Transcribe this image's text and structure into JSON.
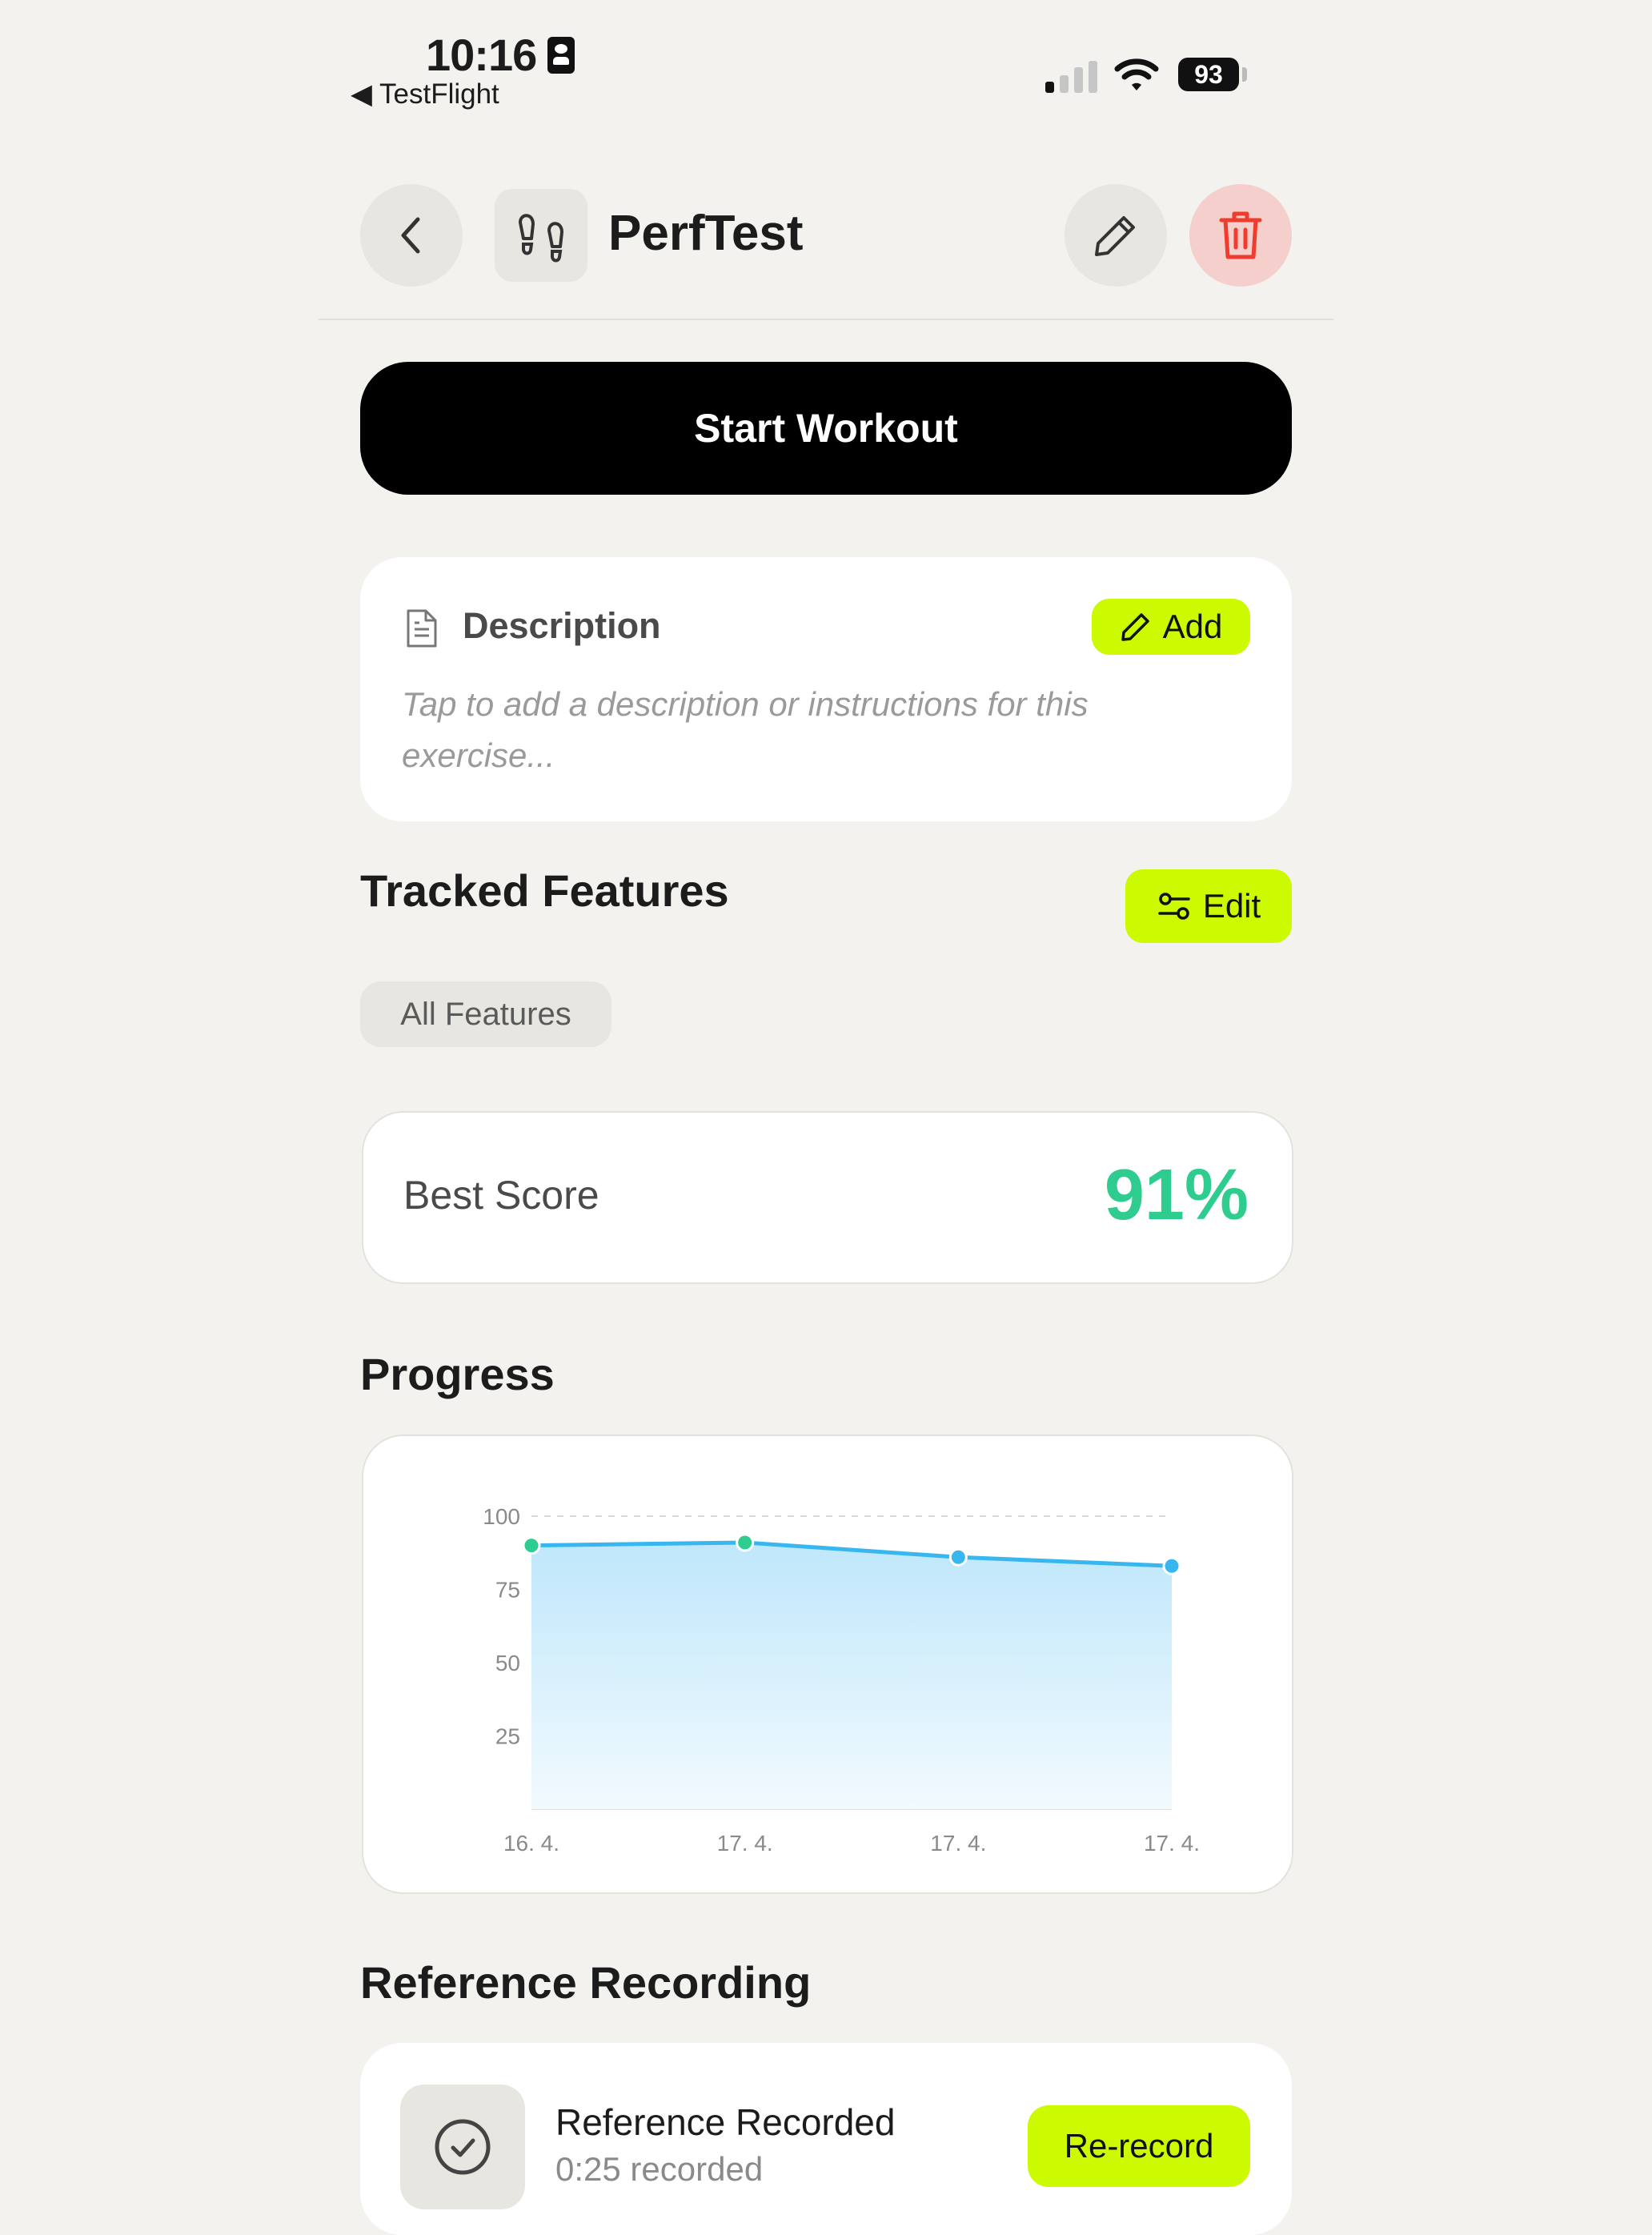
{
  "status_bar": {
    "time": "10:16",
    "back_app": "◀ TestFlight",
    "battery": "93"
  },
  "header": {
    "back_icon": "chevron-left-icon",
    "exercise_icon": "footprints-icon",
    "title": "PerfTest",
    "edit_icon": "pencil-icon",
    "delete_icon": "trash-icon",
    "delete_color": "#f4cfcb"
  },
  "start_workout_label": "Start Workout",
  "description": {
    "title": "Description",
    "add_label": "Add",
    "placeholder": "Tap to add a description or instructions for this exercise..."
  },
  "tracked_features": {
    "title": "Tracked Features",
    "edit_label": "Edit",
    "chip": "All Features"
  },
  "best_score": {
    "label": "Best Score",
    "value": "91%",
    "color": "#2ecc8f"
  },
  "progress": {
    "title": "Progress"
  },
  "chart_data": {
    "type": "area",
    "categories": [
      "16. 4.",
      "17. 4.",
      "17. 4.",
      "17. 4."
    ],
    "values": [
      90,
      91,
      86,
      83
    ],
    "point_colors": [
      "#2ecc8f",
      "#2ecc8f",
      "#38b6f0",
      "#38b6f0"
    ],
    "yticks": [
      100,
      75,
      50,
      25
    ],
    "ylim": [
      0,
      100
    ],
    "grid": true,
    "line_color": "#38b6f0"
  },
  "reference": {
    "title": "Reference Recording",
    "status": "Reference Recorded",
    "duration": "0:25 recorded",
    "rerecord_label": "Re-record",
    "accent": "#ccfa00"
  }
}
